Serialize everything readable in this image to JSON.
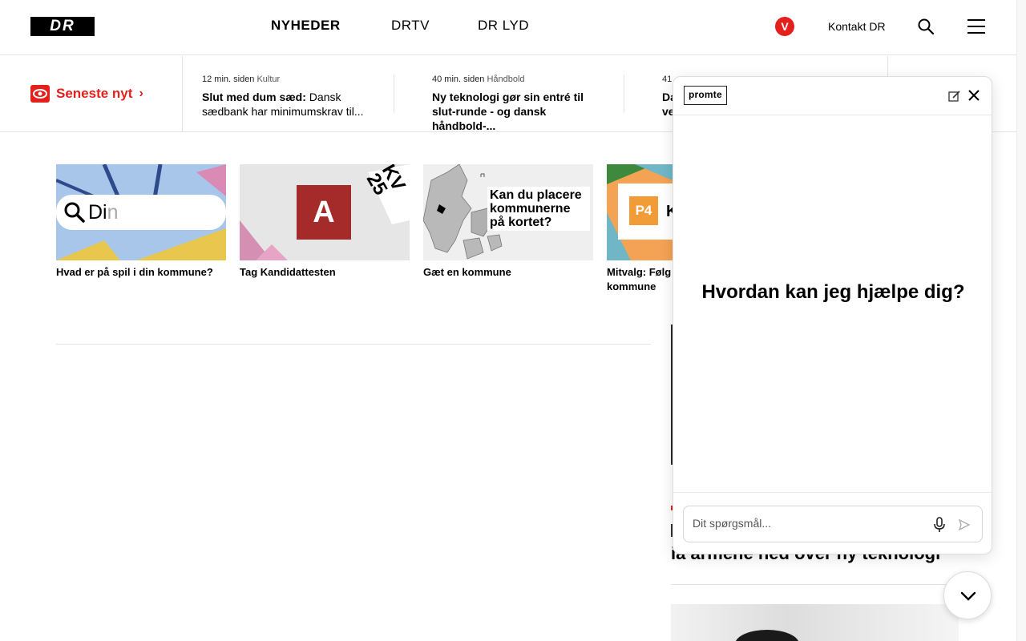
{
  "header": {
    "logo": "DR",
    "nav": [
      "NYHEDER",
      "DRTV",
      "DR LYD"
    ],
    "avatar_letter": "V",
    "contact": "Kontakt DR"
  },
  "latest": {
    "label": "Seneste nyt",
    "chevron": "›",
    "items": [
      {
        "time": "12 min. siden",
        "category": "Kultur",
        "headline_bold": "Slut med dum sæd:",
        "headline": " Dansk sædbank har minimumskrav til..."
      },
      {
        "time": "40 min. siden",
        "category": "Håndbold",
        "headline_bold": "",
        "headline": "Ny teknologi gør sin entré til slut-runde - og dansk håndbold-..."
      },
      {
        "time": "41",
        "category": "",
        "headline_bold": "",
        "headline": "Da ve"
      }
    ]
  },
  "tiles": [
    {
      "caption": "Hvad er på spil i din kommune?",
      "search_text": "Di",
      "search_faded": "n"
    },
    {
      "caption": "Tag Kandidattesten",
      "badge": "A",
      "sticker": "KV 25"
    },
    {
      "caption": "Gæt en kommune",
      "overlay": "Kan du placere kommunerne på kortet?"
    },
    {
      "caption": "Mitvalg: Følg kommune",
      "badge": "P4",
      "partial": "K"
    }
  ],
  "behind": {
    "text": "ia armene ned over ny teknologi"
  },
  "chat": {
    "brand": "promte",
    "question": "Hvordan kan jeg hjælpe dig?",
    "input_placeholder": "Dit spørgsmål..."
  },
  "colors": {
    "accent": "#e3201b",
    "text": "#000000"
  },
  "icons": {
    "search": "search-icon",
    "menu": "hamburger-menu-icon",
    "eye": "eye-icon",
    "mic": "microphone-icon",
    "send": "send-icon",
    "close": "close-icon",
    "edit": "edit-icon",
    "scroll": "chevron-down-icon"
  }
}
